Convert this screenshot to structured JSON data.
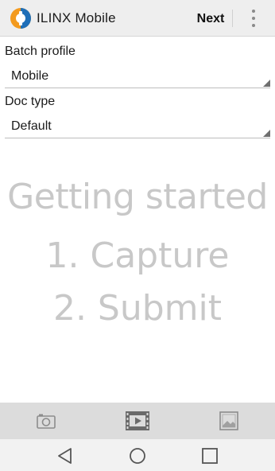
{
  "app": {
    "title": "ILINX Mobile",
    "icon": "ilinx-logo-icon"
  },
  "action_bar": {
    "next_label": "Next",
    "overflow_icon": "more-vert-icon"
  },
  "form": {
    "batch_profile": {
      "label": "Batch profile",
      "value": "Mobile"
    },
    "doc_type": {
      "label": "Doc type",
      "value": "Default"
    }
  },
  "intro": {
    "title": "Getting started",
    "step1": "1. Capture",
    "step2": "2. Submit"
  },
  "toolbar": {
    "items": [
      "camera-icon",
      "video-icon",
      "image-icon"
    ]
  },
  "system_nav": {
    "items": [
      "back-icon",
      "home-icon",
      "recents-icon"
    ]
  },
  "colors": {
    "logo_orange": "#f39a1e",
    "logo_blue": "#1f6fb8",
    "muted_text": "#c8c8c8",
    "toolbar_bg": "#dcdcdc"
  }
}
